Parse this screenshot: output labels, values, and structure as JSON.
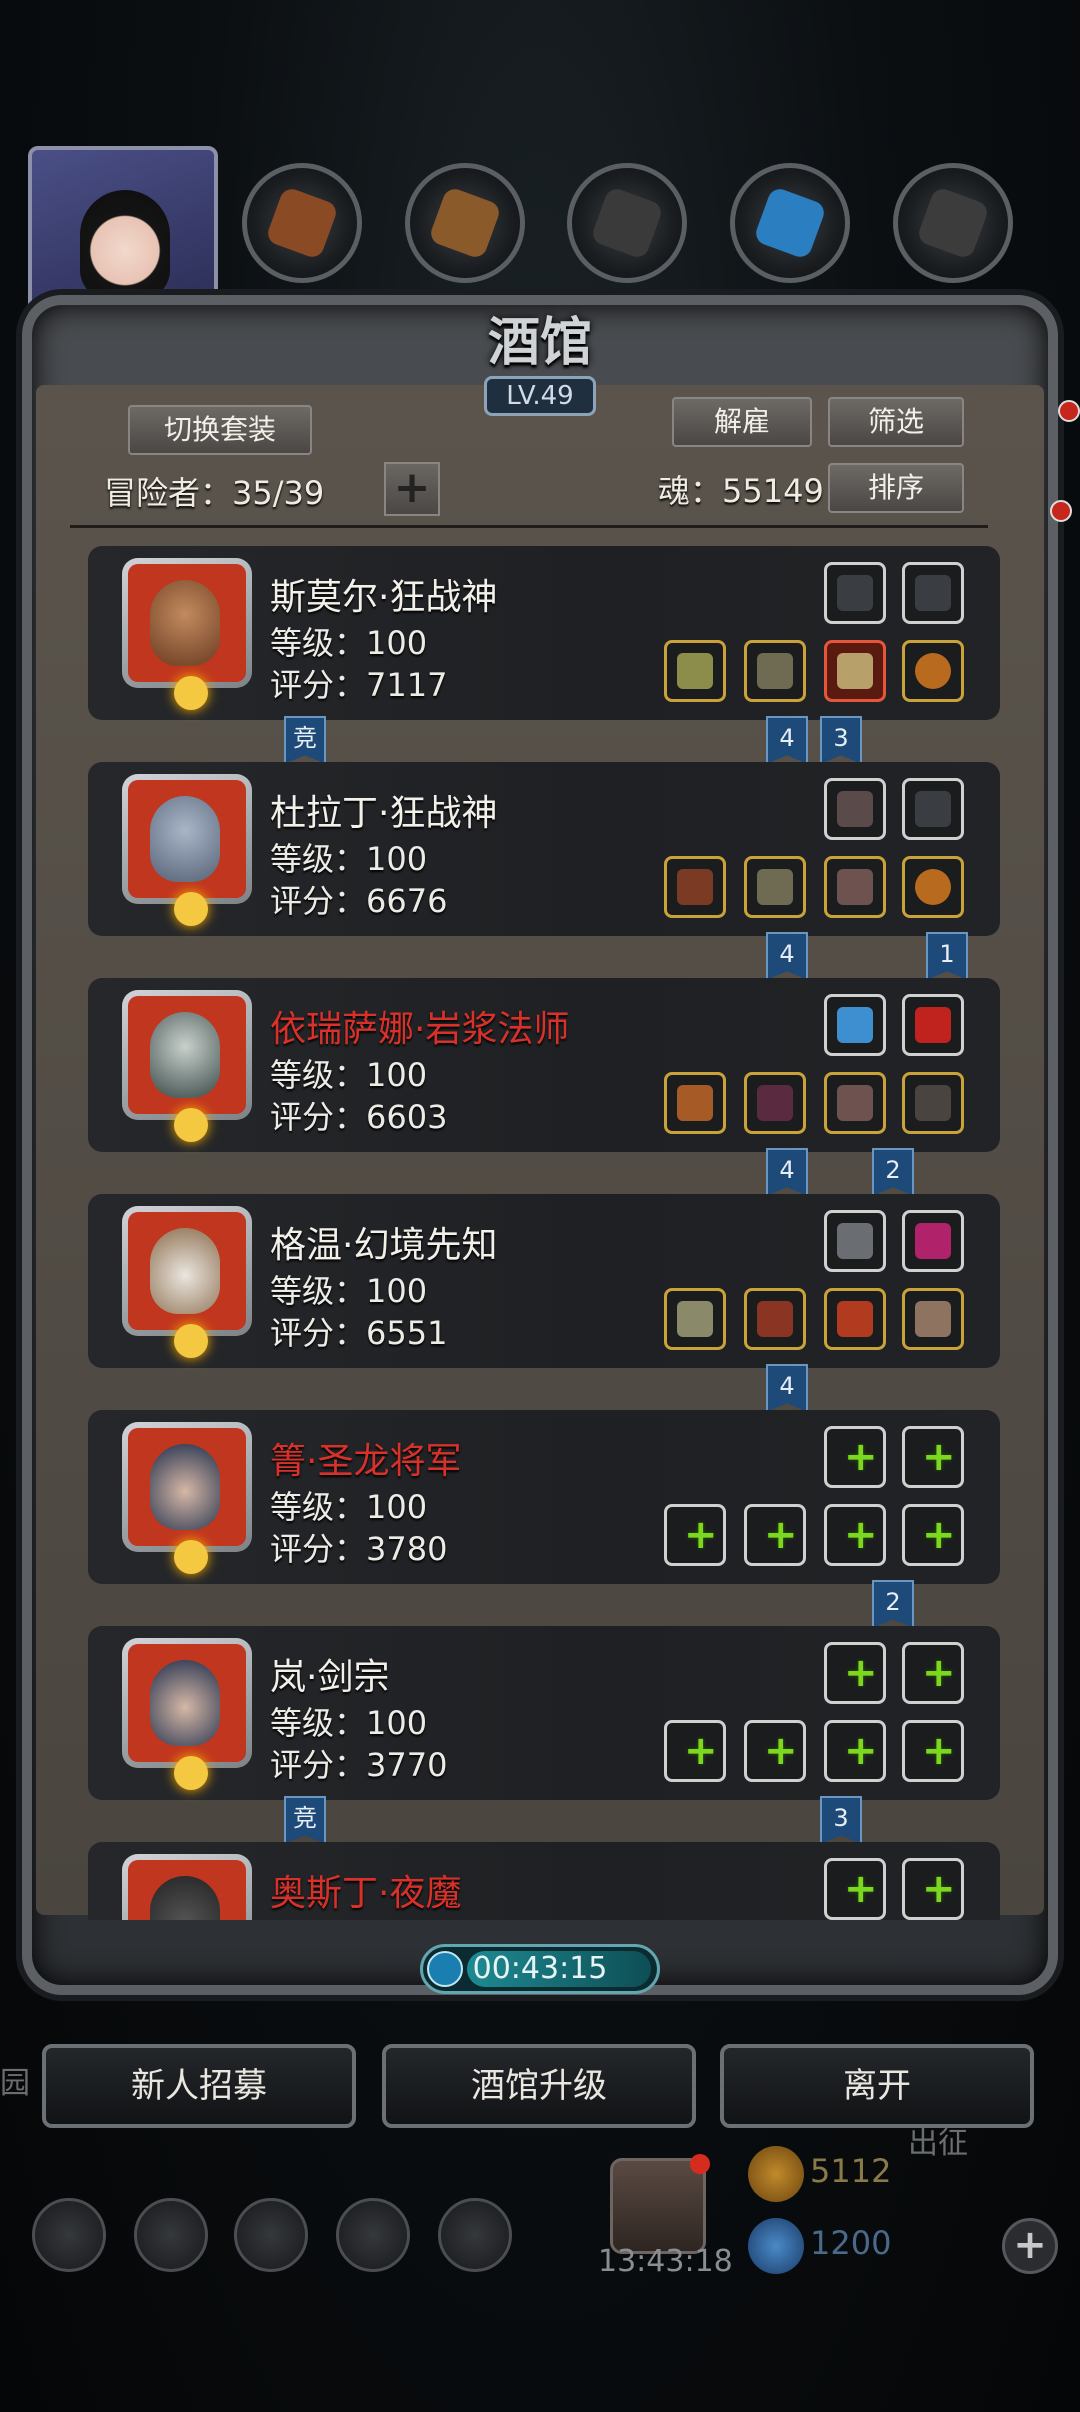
{
  "tavern": {
    "title": "酒馆",
    "level": "LV.49",
    "switch_outfit": "切换套装",
    "dismiss": "解雇",
    "filter": "筛选",
    "sort": "排序",
    "adventurer_count": "冒险者：35/39",
    "soul": "魂：55149",
    "add_symbol": "+"
  },
  "heroes": [
    {
      "name": "斯莫尔·狂战神",
      "level": "等级：100",
      "score": "评分：7117",
      "name_color": "white",
      "tags": [
        "竞",
        "4",
        "3"
      ]
    },
    {
      "name": "杜拉丁·狂战神",
      "level": "等级：100",
      "score": "评分：6676",
      "name_color": "white",
      "tags": [
        "4",
        "1"
      ]
    },
    {
      "name": "依瑞萨娜·岩浆法师",
      "level": "等级：100",
      "score": "评分：6603",
      "name_color": "red",
      "tags": [
        "4",
        "2"
      ]
    },
    {
      "name": "格温·幻境先知",
      "level": "等级：100",
      "score": "评分：6551",
      "name_color": "white",
      "tags": [
        "4"
      ]
    },
    {
      "name": "箐·圣龙将军",
      "level": "等级：100",
      "score": "评分：3780",
      "name_color": "red",
      "tags": [
        "2"
      ]
    },
    {
      "name": "岚·剑宗",
      "level": "等级：100",
      "score": "评分：3770",
      "name_color": "white",
      "tags": [
        "竞",
        "3"
      ]
    },
    {
      "name": "奥斯丁·夜魔",
      "name_color": "red"
    }
  ],
  "timer": "00:43:15",
  "bottom_buttons": {
    "recruit": "新人招募",
    "upgrade": "酒馆升级",
    "leave": "离开"
  },
  "background": {
    "gift_timer": "13:43:18",
    "gold": "5112",
    "gems": "1200",
    "left_label": "园",
    "right_label": "出征"
  }
}
